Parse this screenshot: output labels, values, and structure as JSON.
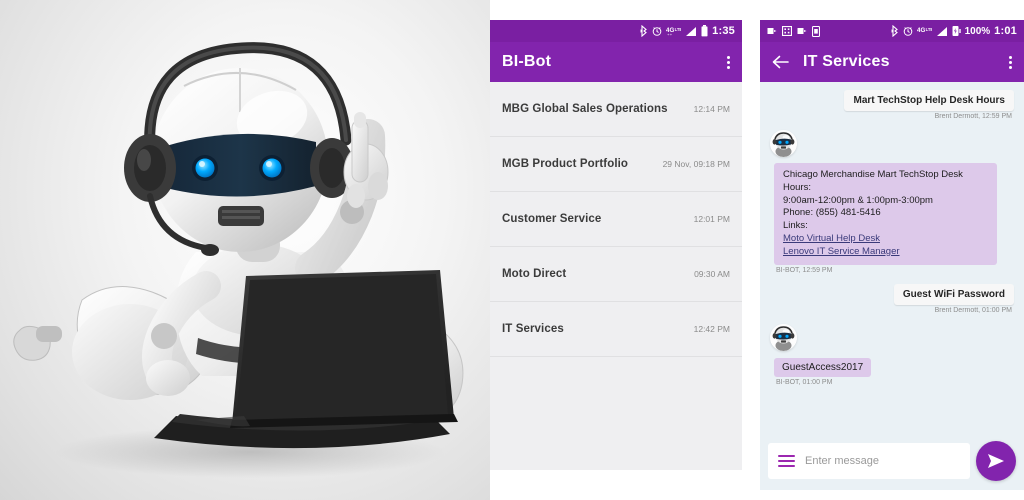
{
  "hero": {
    "alt": "3d-robot-with-headset-using-laptop",
    "robot_body_color": "#e8e8e8",
    "visor_color": "#1b2f44",
    "eye_color": "#00a8ff",
    "laptop_color": "#2b2b2b",
    "background_color": "#e4e4e4"
  },
  "list_phone": {
    "status_bar": {
      "icons": [
        "bluetooth-icon",
        "alarm-icon",
        "4g-lte-icon",
        "signal-icon",
        "battery-icon"
      ],
      "time": "1:35"
    },
    "app_bar": {
      "title": "BI-Bot",
      "menu_icon": "kebab-menu-icon"
    },
    "items": [
      {
        "title": "MBG Global Sales Operations",
        "time": "12:14 PM"
      },
      {
        "title": "MGB Product Portfolio",
        "time": "29 Nov, 09:18 PM"
      },
      {
        "title": "Customer Service",
        "time": "12:01 PM"
      },
      {
        "title": "Moto Direct",
        "time": "09:30 AM"
      },
      {
        "title": "IT Services",
        "time": "12:42 PM"
      }
    ]
  },
  "chat_phone": {
    "status_bar": {
      "notification_icons": [
        "usb-icon",
        "screenshot-icon",
        "usb-debug-icon",
        "sim-icon"
      ],
      "icons": [
        "bluetooth-icon",
        "alarm-icon",
        "4g-lte-icon",
        "signal-icon",
        "battery-charging-icon"
      ],
      "battery_percent": "100%",
      "time": "1:01"
    },
    "app_bar": {
      "back_icon": "back-arrow-icon",
      "title": "IT Services",
      "menu_icon": "kebab-menu-icon"
    },
    "messages": [
      {
        "sender": "user",
        "text": "Mart TechStop Help Desk Hours",
        "meta": "Brent Dermott, 12:59 PM"
      },
      {
        "sender": "bot",
        "lines": [
          "Chicago Merchandise Mart TechStop Desk Hours:",
          "9:00am-12:00pm & 1:00pm-3:00pm",
          "Phone: (855) 481-5416",
          "Links:"
        ],
        "links": [
          "Moto Virtual Help Desk",
          "Lenovo IT Service Manager"
        ],
        "meta": "BI-BOT, 12:59 PM"
      },
      {
        "sender": "user",
        "text": "Guest WiFi Password",
        "meta": "Brent Dermott, 01:00 PM"
      },
      {
        "sender": "bot",
        "text": "GuestAccess2017",
        "meta": "BI-BOT, 01:00 PM"
      }
    ],
    "input": {
      "placeholder": "Enter message",
      "value": "",
      "menu_icon": "hamburger-icon",
      "send_icon": "send-icon"
    }
  },
  "colors": {
    "purple_dark": "#7a1fa2",
    "purple": "#8224ad",
    "bot_bubble": "#ddc9ea",
    "chat_bg": "#eaf1f5",
    "list_bg": "#efeff1"
  }
}
